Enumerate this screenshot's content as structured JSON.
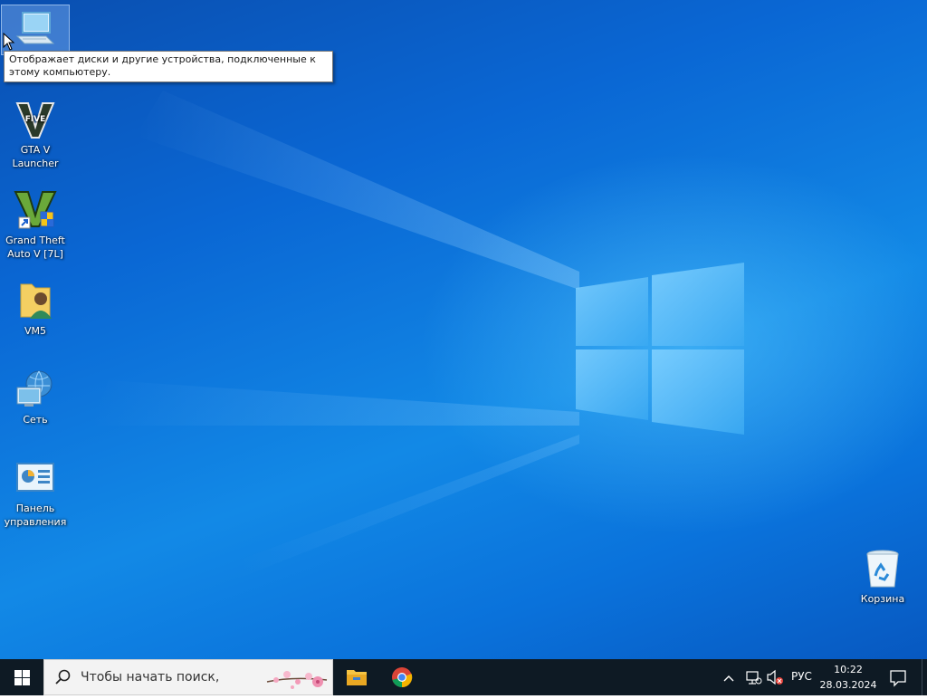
{
  "desktop": {
    "icons": [
      {
        "label": "",
        "icon": "computer-icon"
      },
      {
        "label": "GTA V\nLauncher",
        "icon": "gta-v-launcher-icon"
      },
      {
        "label": "Grand Theft Auto V [7L]",
        "icon": "gta-v-game-icon"
      },
      {
        "label": "VM5",
        "icon": "user-folder-icon"
      },
      {
        "label": "Сеть",
        "icon": "network-icon"
      },
      {
        "label": "Панель управления",
        "icon": "control-panel-icon"
      },
      {
        "label": "Корзина",
        "icon": "recycle-bin-icon"
      }
    ],
    "tooltip": "Отображает диски и другие устройства, подключенные к этому компьютеру."
  },
  "taskbar": {
    "search_placeholder": "Чтобы начать поиск,",
    "apps": [
      {
        "icon": "file-explorer-icon"
      },
      {
        "icon": "chrome-icon"
      }
    ],
    "tray": {
      "language": "РУС",
      "time": "10:22",
      "date": "28.03.2024"
    }
  },
  "colors": {
    "taskbar_bg": "#0e1a24",
    "desktop_accent": "#0a67d4"
  }
}
